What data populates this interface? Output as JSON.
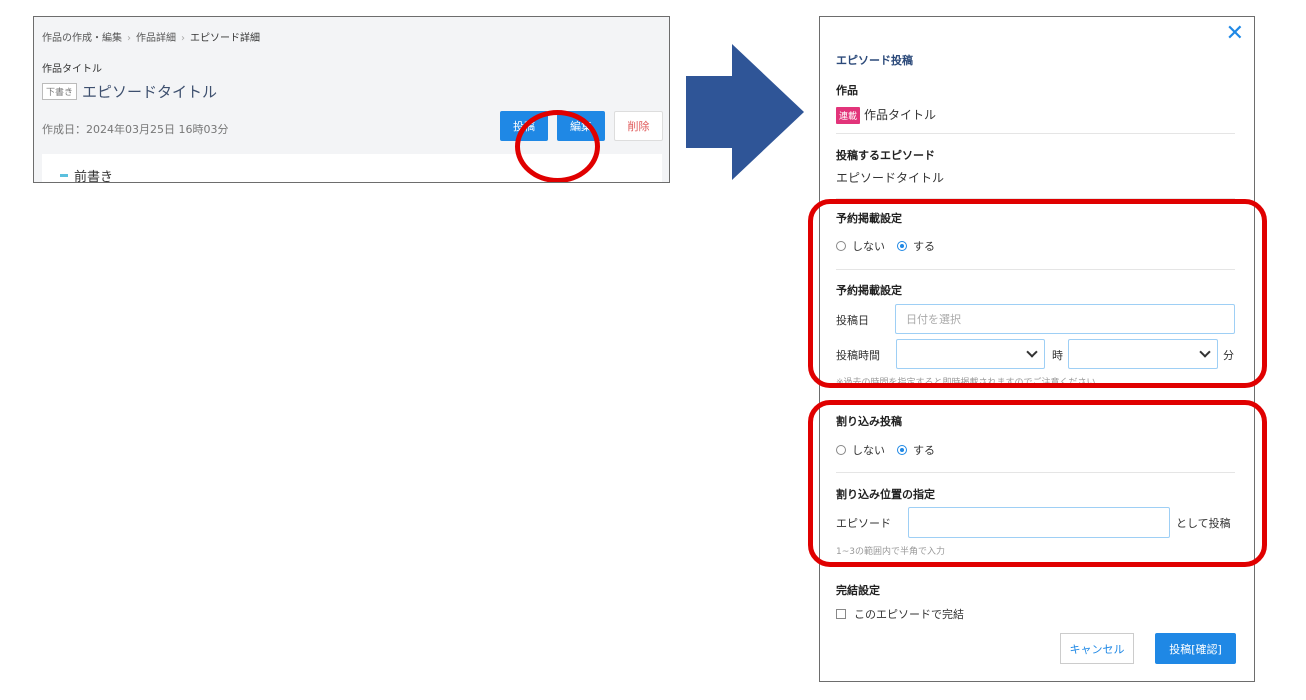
{
  "left": {
    "breadcrumb": [
      "作品の作成・編集",
      "作品詳細",
      "エピソード詳細"
    ],
    "breadcrumb_sep": "›",
    "work_title": "作品タイトル",
    "draft_badge": "下書き",
    "episode_title": "エピソードタイトル",
    "created": "作成日：2024年03月25日 16時03分",
    "buttons": {
      "post": "投稿",
      "edit": "編集",
      "delete": "削除"
    },
    "preface": "前書き"
  },
  "modal": {
    "close": "✕",
    "title": "エピソード投稿",
    "work_label": "作品",
    "serial_badge": "連載",
    "work_title": "作品タイトル",
    "episode_label": "投稿するエピソード",
    "episode_title": "エピソードタイトル",
    "schedule": {
      "label": "予約掲載設定",
      "no": "しない",
      "yes": "する",
      "selected": "する",
      "settings_label": "予約掲載設定",
      "date_label": "投稿日",
      "date_placeholder": "日付を選択",
      "time_label": "投稿時間",
      "hour_unit": "時",
      "minute_unit": "分",
      "note": "※過去の時間を指定すると即時掲載されますのでご注意ください"
    },
    "interrupt": {
      "label": "割り込み投稿",
      "no": "しない",
      "yes": "する",
      "selected": "する",
      "position_label": "割り込み位置の指定",
      "episode_label": "エピソード",
      "suffix": "として投稿",
      "note": "1~3の範囲内で半角で入力"
    },
    "complete": {
      "label": "完結設定",
      "checkbox": "このエピソードで完結"
    },
    "buttons": {
      "cancel": "キャンセル",
      "confirm": "投稿[確認]"
    }
  },
  "colors": {
    "accent": "#1f88e5",
    "highlight": "#e00000",
    "arrow": "#2f5597",
    "badge": "#e2347a"
  }
}
